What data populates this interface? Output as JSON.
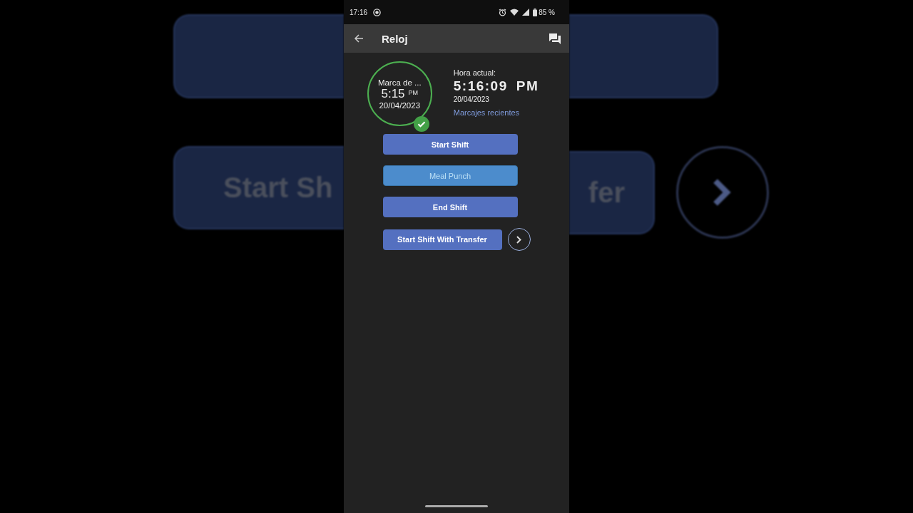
{
  "backdrop": {
    "left_text": "Start Sh",
    "right_text": "fer"
  },
  "status_bar": {
    "time": "17:16",
    "battery": "85 %"
  },
  "app_bar": {
    "title": "Reloj"
  },
  "last_punch": {
    "label": "Marca de ...",
    "time": "5:15",
    "period": "PM",
    "date": "20/04/2023",
    "confirmed": true
  },
  "current": {
    "label": "Hora actual:",
    "time": "5:16:09",
    "period": "PM",
    "date": "20/04/2023",
    "link": "Marcajes recientes"
  },
  "buttons": [
    {
      "label": "Start Shift",
      "selected": false
    },
    {
      "label": "Meal Punch",
      "selected": true
    },
    {
      "label": "End Shift",
      "selected": false
    }
  ],
  "transfer_button": {
    "label": "Start Shift With Transfer"
  }
}
